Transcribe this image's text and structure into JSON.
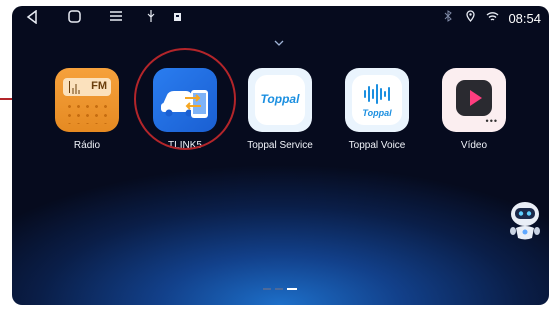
{
  "statusbar": {
    "nav_icons": [
      "back-icon",
      "home-icon",
      "menu-icon",
      "usb-icon",
      "sd-card-icon"
    ],
    "status_icons": [
      "bluetooth-icon",
      "location-icon",
      "wifi-icon"
    ],
    "time": "08:54"
  },
  "apps": [
    {
      "label": "Rádio",
      "icon": "radio-icon",
      "tile_text": "FM"
    },
    {
      "label": "TLINK5",
      "icon": "tlink5-icon"
    },
    {
      "label": "Toppal Service",
      "icon": "toppal-service-icon",
      "tile_text": "Toppal"
    },
    {
      "label": "Toppal Voice",
      "icon": "toppal-voice-icon",
      "tile_text": "Toppal"
    },
    {
      "label": "Vídeo",
      "icon": "video-play-icon"
    }
  ],
  "colors": {
    "highlight": "#b3252a",
    "radio": "#f29a30",
    "tlink": "#2372e8",
    "toppal": "#1b8fe0"
  },
  "pager": {
    "pages": 3,
    "active_page": 3
  }
}
